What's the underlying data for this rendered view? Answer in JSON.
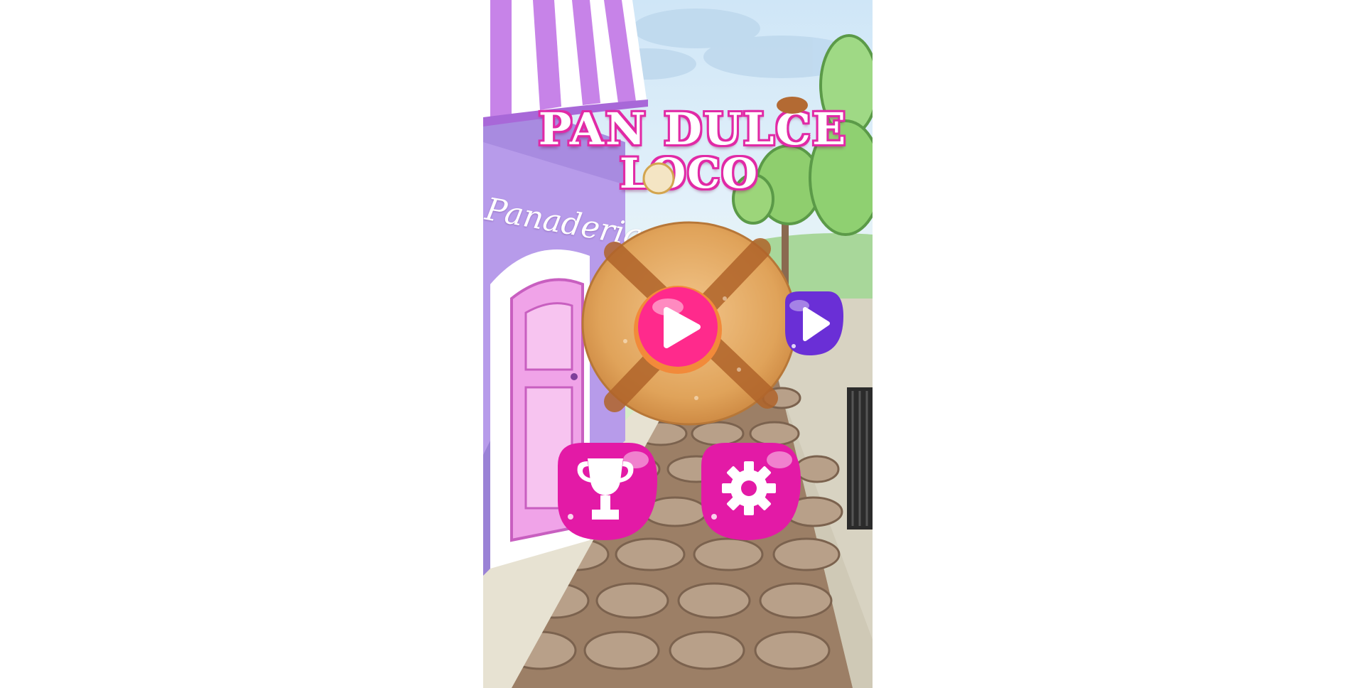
{
  "game": {
    "title_line1": "PAN DULCE",
    "title_line2": "LOCO",
    "shop_sign": "Panaderia",
    "buttons": {
      "play": {
        "icon": "play-icon"
      },
      "next": {
        "icon": "play-icon"
      },
      "leaderboard": {
        "icon": "trophy-icon"
      },
      "settings": {
        "icon": "gear-icon"
      }
    },
    "colors": {
      "accent_pink": "#e31aa6",
      "play_pink": "#ff2a8c",
      "next_purple": "#6a2fd6",
      "bread": "#e0a35a"
    }
  }
}
